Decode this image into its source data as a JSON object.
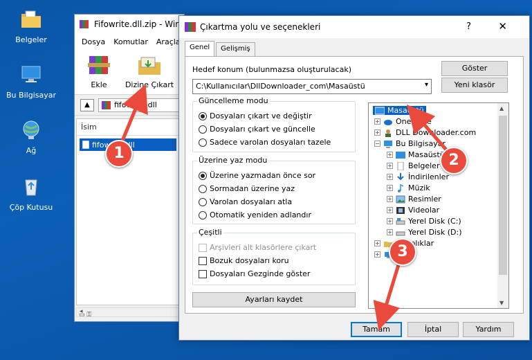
{
  "desktop": {
    "icons": [
      {
        "label": "Belgeler",
        "icon": "documents-folder-icon"
      },
      {
        "label": "Bu Bilgisayar",
        "icon": "computer-icon"
      },
      {
        "label": "Ağ",
        "icon": "network-icon"
      },
      {
        "label": "Çöp Kutusu",
        "icon": "recycle-bin-icon"
      }
    ]
  },
  "winrar": {
    "title": "Fifowrite.dll.zip - Win",
    "menu": [
      "Dosya",
      "Komutlar",
      "Araçla"
    ],
    "toolbar": {
      "add_label": "Ekle",
      "extract_label": "Dizine Çıkart"
    },
    "address": "fifowrite.dll",
    "column_name": "İsim",
    "selected_file": "fifowrite.dll"
  },
  "dialog": {
    "title": "Çıkartma yolu ve seçenekleri",
    "help_glyph": "?",
    "close_glyph": "✕",
    "tabs": [
      "Genel",
      "Gelişmiş"
    ],
    "dest_label": "Hedef konum (bulunmazsa oluşturulacak)",
    "dest_value": "C:\\Kullanıcılar\\DllDownloader_com\\Masaüstü",
    "show_button": "Göster",
    "new_folder_button": "Yeni klasör",
    "update_mode": {
      "title": "Güncelleme modu",
      "options": [
        "Dosyaları çıkart ve değiştir",
        "Dosyaları çıkart ve güncelle",
        "Sadece varolan dosyaları tazele"
      ],
      "selected": 0
    },
    "overwrite_mode": {
      "title": "Üzerine yaz modu",
      "options": [
        "Üzerine yazmadan önce sor",
        "Sormadan üzerine yaz",
        "Varolan dosyaları atla",
        "Otomatik yeniden adlandır"
      ],
      "selected": 0
    },
    "misc": {
      "title": "Çeşitli",
      "options": [
        "Arşivleri alt klasörlere çıkart",
        "Bozuk dosyaları koru",
        "Dosyaları Gezginde göster"
      ]
    },
    "save_settings_button": "Ayarları kaydet",
    "tree": [
      {
        "label": "Masaüstü",
        "selected": true
      },
      {
        "label": "OneDrive"
      },
      {
        "label": "DLL Downloader.com"
      },
      {
        "label": "Bu Bilgisayar"
      },
      {
        "label": "Masaüstü"
      },
      {
        "label": "Belgeler"
      },
      {
        "label": "İndirilenler"
      },
      {
        "label": "Müzik"
      },
      {
        "label": "Resimler"
      },
      {
        "label": "Videolar"
      },
      {
        "label": "Yerel Disk (C:)"
      },
      {
        "label": "Yerel Disk (D:)"
      },
      {
        "label": "Kitaplıklar"
      },
      {
        "label": "Ağ"
      }
    ],
    "ok_button": "Tamam",
    "cancel_button": "İptal",
    "help_button": "Yardım"
  },
  "callouts": [
    "1",
    "2",
    "3"
  ],
  "colors": {
    "accent": "#0078d7",
    "callout": "#e94a3c",
    "selection": "#0a5fc2"
  }
}
